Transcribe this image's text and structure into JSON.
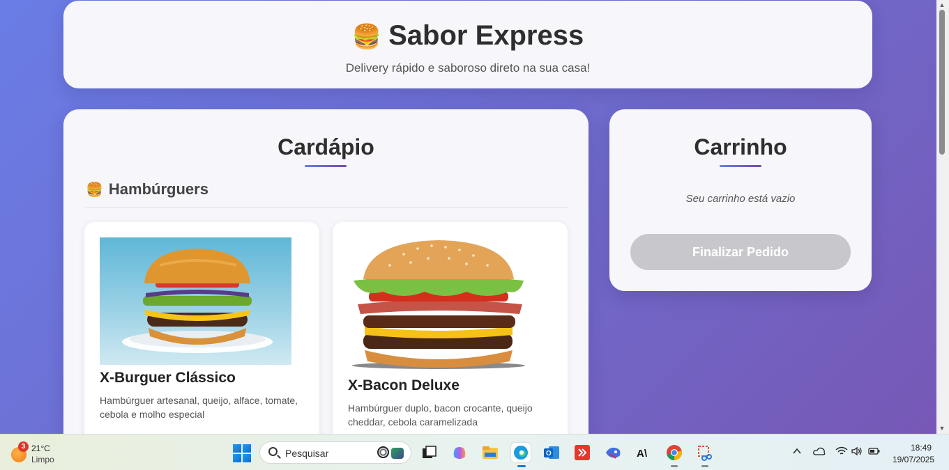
{
  "header": {
    "emoji": "🍔",
    "title": "Sabor Express",
    "subtitle": "Delivery rápido e saboroso direto na sua casa!"
  },
  "menu": {
    "title": "Cardápio",
    "category": {
      "emoji": "🍔",
      "name": "Hambúrguers"
    },
    "products": [
      {
        "name": "X-Burguer Clássico",
        "description": "Hambúrguer artesanal, queijo, alface, tomate, cebola e molho especial"
      },
      {
        "name": "X-Bacon Deluxe",
        "description": "Hambúrguer duplo, bacon crocante, queijo cheddar, cebola caramelizada"
      }
    ]
  },
  "cart": {
    "title": "Carrinho",
    "empty_text": "Seu carrinho está vazio",
    "checkout_label": "Finalizar Pedido"
  },
  "colors": {
    "accent_start": "#667eea",
    "accent_end": "#764ba2",
    "disabled_button": "#c8c8cc"
  },
  "taskbar": {
    "weather_badge": "3",
    "temperature": "21°C",
    "condition": "Limpo",
    "search_placeholder": "Pesquisar",
    "time": "18:49",
    "date": "19/07/2025",
    "pinned_icons": [
      "windows-start-icon",
      "search-icon",
      "task-view-icon",
      "copilot-icon",
      "file-explorer-icon",
      "edge-icon",
      "outlook-icon",
      "anydesk-icon",
      "bird-app-icon",
      "anthropic-icon",
      "chrome-icon",
      "snipping-tool-icon"
    ],
    "tray_icons": [
      "chevron-up-icon",
      "onedrive-icon",
      "wifi-icon",
      "volume-icon",
      "battery-icon"
    ]
  }
}
